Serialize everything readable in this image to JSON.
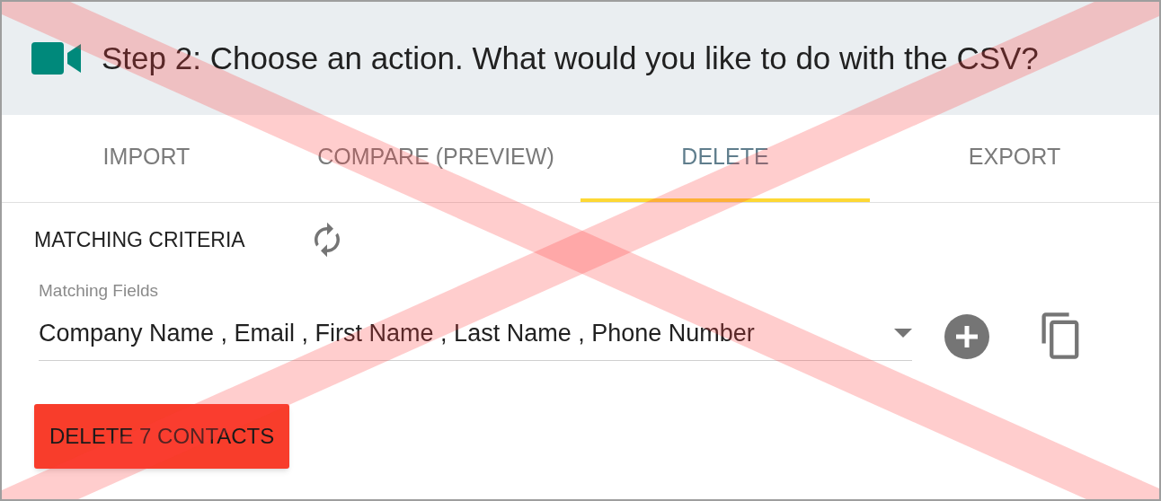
{
  "header": {
    "title": "Step 2: Choose an action. What would you like to do with the CSV?"
  },
  "tabs": [
    {
      "label": "IMPORT",
      "selected": false
    },
    {
      "label": "COMPARE (PREVIEW)",
      "selected": false
    },
    {
      "label": "DELETE",
      "selected": true
    },
    {
      "label": "EXPORT",
      "selected": false
    }
  ],
  "section": {
    "title": "MATCHING CRITERIA"
  },
  "matching_fields": {
    "label": "Matching Fields",
    "value": "Company Name , Email , First Name , Last Name , Phone Number"
  },
  "delete_button": {
    "label": "DELETE 7 CONTACTS"
  }
}
